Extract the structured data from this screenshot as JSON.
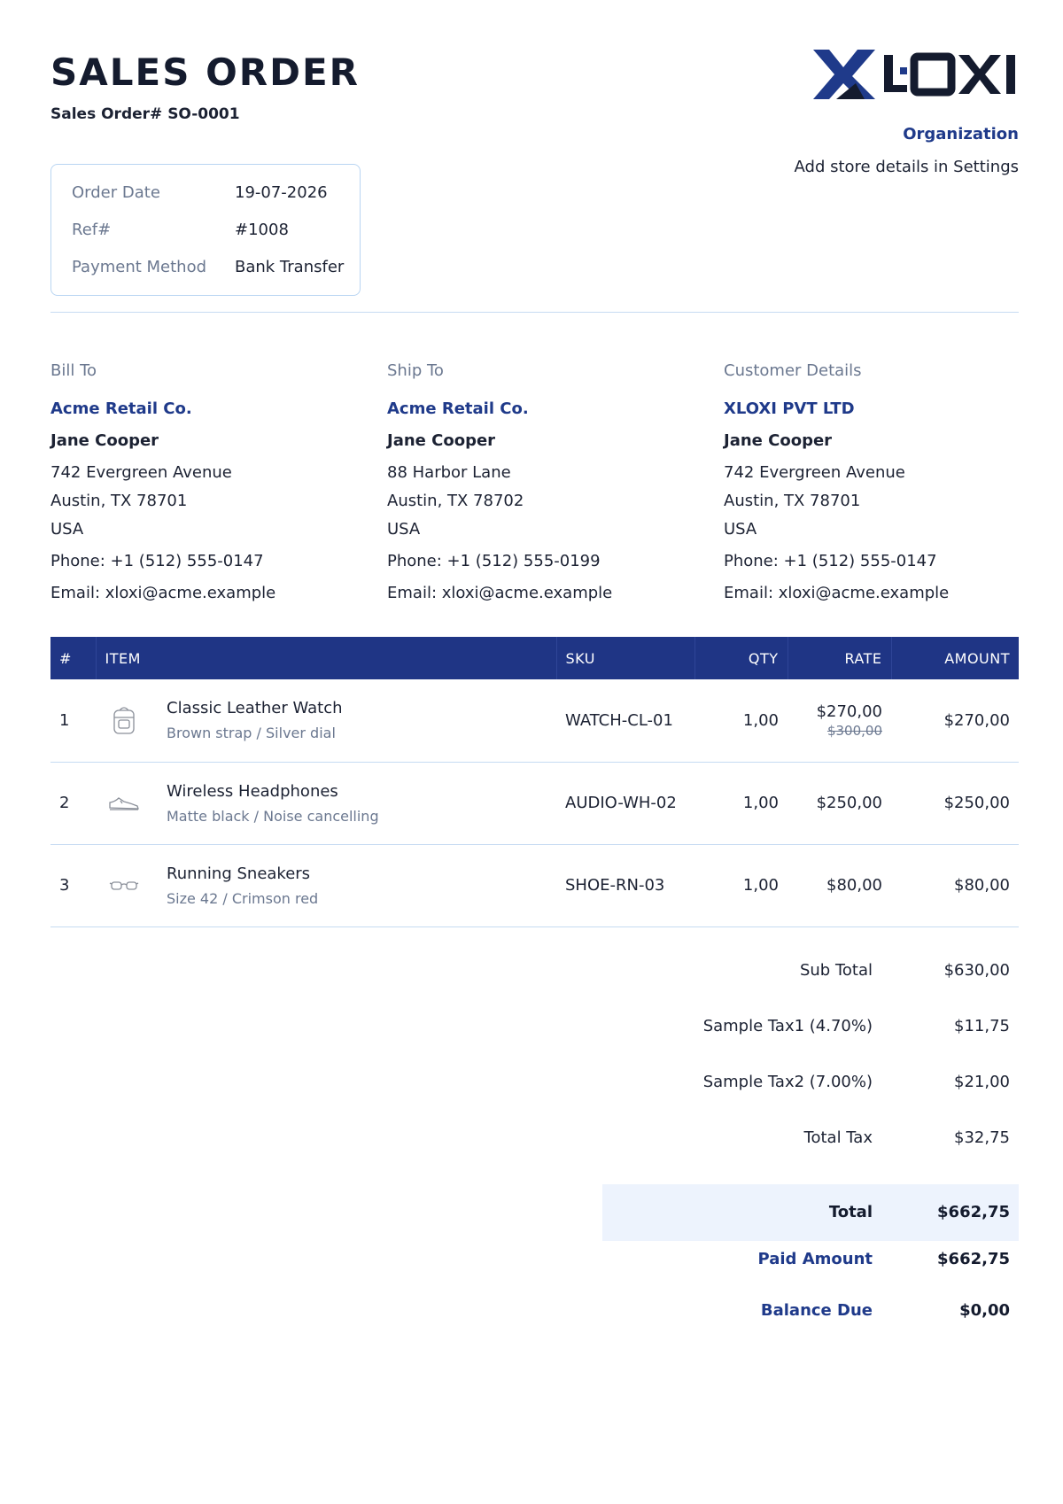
{
  "document": {
    "title": "SALES ORDER",
    "number_label": "Sales Order# SO-0001"
  },
  "organization": {
    "logo_text": "XLOXI",
    "name": "Organization",
    "note": "Add store details in Settings",
    "brand_color": "#1f3a8a"
  },
  "meta": [
    {
      "label": "Order Date",
      "value": "19-07-2026"
    },
    {
      "label": "Ref#",
      "value": "#1008"
    },
    {
      "label": "Payment Method",
      "value": "Bank Transfer"
    }
  ],
  "bill_to": {
    "label": "Bill To",
    "company": "Acme Retail Co.",
    "person": "Jane Cooper",
    "address": [
      "742 Evergreen Avenue",
      "Austin, TX 78701",
      "USA"
    ],
    "phone": "Phone: +1 (512) 555-0147",
    "email": "Email: xloxi@acme.example"
  },
  "ship_to": {
    "label": "Ship To",
    "company": "Acme Retail Co.",
    "person": "Jane Cooper",
    "address": [
      "88 Harbor Lane",
      "Austin, TX 78702",
      "USA"
    ],
    "phone": "Phone: +1 (512) 555-0199",
    "email": "Email: xloxi@acme.example"
  },
  "customer": {
    "label": "Customer Details",
    "company": "XLOXI PVT LTD",
    "person": "Jane Cooper",
    "address": [
      "742 Evergreen Avenue",
      "Austin, TX 78701",
      "USA"
    ],
    "phone": "Phone: +1 (512) 555-0147",
    "email": "Email: xloxi@acme.example"
  },
  "table": {
    "headers": {
      "num": "#",
      "item": "ITEM",
      "sku": "SKU",
      "qty": "QTY",
      "rate": "RATE",
      "amount": "AMOUNT"
    },
    "rows": [
      {
        "num": "1",
        "icon": "backpack-icon",
        "name": "Classic Leather Watch",
        "desc": "Brown strap / Silver dial",
        "sku": "WATCH-CL-01",
        "qty": "1,00",
        "rate": "$270,00",
        "rate_old": "$300,00",
        "amount": "$270,00"
      },
      {
        "num": "2",
        "icon": "sneaker-icon",
        "name": "Wireless Headphones",
        "desc": "Matte black / Noise cancelling",
        "sku": "AUDIO-WH-02",
        "qty": "1,00",
        "rate": "$250,00",
        "rate_old": "",
        "amount": "$250,00"
      },
      {
        "num": "3",
        "icon": "glasses-icon",
        "name": "Running Sneakers",
        "desc": "Size 42 / Crimson red",
        "sku": "SHOE-RN-03",
        "qty": "1,00",
        "rate": "$80,00",
        "rate_old": "",
        "amount": "$80,00"
      }
    ]
  },
  "totals": {
    "sub_total": {
      "label": "Sub Total",
      "value": "$630,00"
    },
    "tax1": {
      "label": "Sample Tax1 (4.70%)",
      "value": "$11,75"
    },
    "tax2": {
      "label": "Sample Tax2 (7.00%)",
      "value": "$21,00"
    },
    "total_tax": {
      "label": "Total Tax",
      "value": "$32,75"
    },
    "total": {
      "label": "Total",
      "value": "$662,75"
    },
    "paid": {
      "label": "Paid Amount",
      "value": "$662,75"
    },
    "balance": {
      "label": "Balance Due",
      "value": "$0,00"
    }
  }
}
